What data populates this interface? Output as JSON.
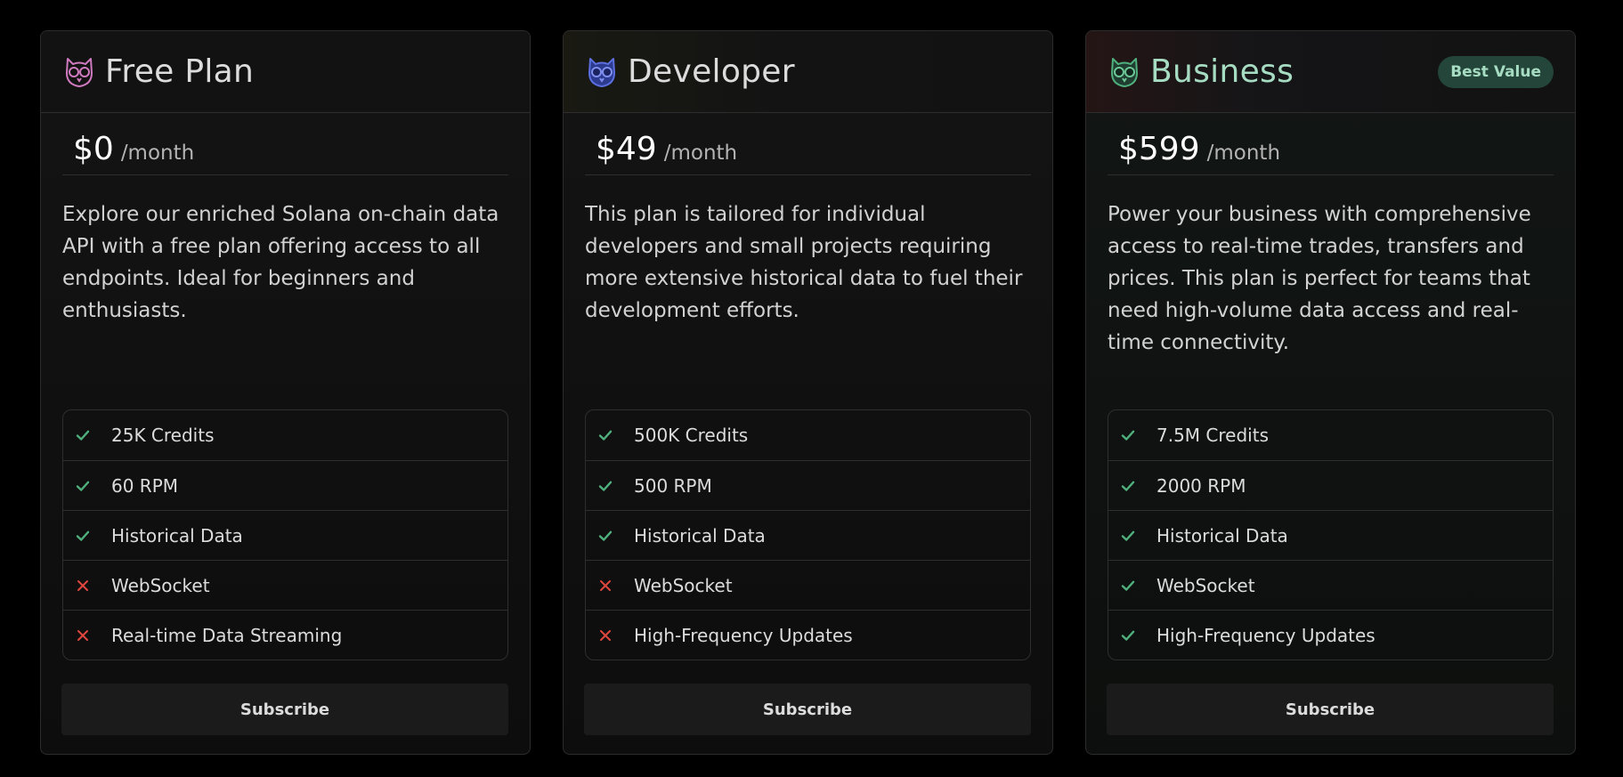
{
  "colors": {
    "check": "#4fb07d",
    "cross": "#e0473f",
    "badge_bg": "#24453a",
    "badge_text": "#a6dcc2",
    "business_name": "#a6dcc2"
  },
  "plans": [
    {
      "name": "Free Plan",
      "icon": "owl-logo-pink-icon",
      "logo_color": "#d07ac0",
      "name_color": "#dcdcdc",
      "badge": "",
      "price": "$0",
      "period": "/month",
      "description": "Explore our enriched Solana on-chain data API with a free plan offering access to all endpoints. Ideal for beginners and enthusiasts.",
      "features": [
        {
          "label": "25K Credits",
          "included": true
        },
        {
          "label": "60 RPM",
          "included": true
        },
        {
          "label": "Historical Data",
          "included": true
        },
        {
          "label": "WebSocket",
          "included": false
        },
        {
          "label": "Real-time Data Streaming",
          "included": false
        }
      ],
      "button": "Subscribe"
    },
    {
      "name": "Developer",
      "icon": "owl-logo-blue-icon",
      "logo_color": "#5b6fe0",
      "name_color": "#dcdcdc",
      "badge": "",
      "price": "$49",
      "period": "/month",
      "description": "This plan is tailored for individual developers and small projects requiring more extensive historical data to fuel their development efforts.",
      "features": [
        {
          "label": "500K Credits",
          "included": true
        },
        {
          "label": "500 RPM",
          "included": true
        },
        {
          "label": "Historical Data",
          "included": true
        },
        {
          "label": "WebSocket",
          "included": false
        },
        {
          "label": "High-Frequency Updates",
          "included": false
        }
      ],
      "button": "Subscribe"
    },
    {
      "name": "Business",
      "icon": "owl-logo-green-icon",
      "logo_color": "#4fb07d",
      "name_color": "#a6dcc2",
      "badge": "Best Value",
      "price": "$599",
      "period": "/month",
      "description": "Power your business with comprehensive access to real-time trades, transfers and prices. This plan is perfect for teams that need high-volume data access and real-time connectivity.",
      "features": [
        {
          "label": "7.5M Credits",
          "included": true
        },
        {
          "label": "2000 RPM",
          "included": true
        },
        {
          "label": "Historical Data",
          "included": true
        },
        {
          "label": "WebSocket",
          "included": true
        },
        {
          "label": "High-Frequency Updates",
          "included": true
        }
      ],
      "button": "Subscribe"
    }
  ]
}
